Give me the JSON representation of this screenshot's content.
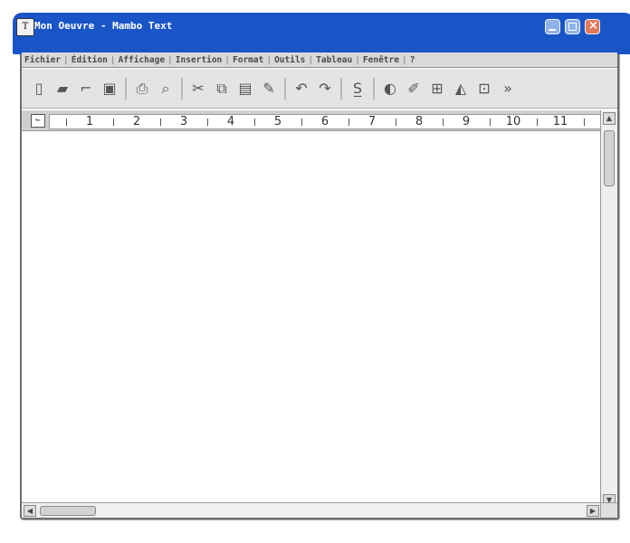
{
  "window": {
    "title": "Mon Oeuvre - Mambo Text",
    "app_icon_label": "T",
    "title_bar_color": "#1a55c8",
    "controls": {
      "minimize_icon": "minimize-icon",
      "maximize_icon": "maximize-icon",
      "close_icon": "close-icon"
    }
  },
  "menu": {
    "items": [
      "Fichier",
      "Édition",
      "Affichage",
      "Insertion",
      "Format",
      "Outils",
      "Tableau",
      "Fenêtre",
      "?"
    ]
  },
  "toolbar": {
    "buttons": [
      {
        "icon": "new-document-icon",
        "glyph": "▯"
      },
      {
        "icon": "open-folder-icon",
        "glyph": "▰"
      },
      {
        "icon": "open-file-icon",
        "glyph": "⌐"
      },
      {
        "icon": "save-icon",
        "glyph": "▣"
      },
      {
        "icon": "print-icon",
        "glyph": "⎙"
      },
      {
        "icon": "print-preview-icon",
        "glyph": "⌕"
      },
      {
        "icon": "cut-icon",
        "glyph": "✂"
      },
      {
        "icon": "copy-icon",
        "glyph": "⧉"
      },
      {
        "icon": "paste-icon",
        "glyph": "▤"
      },
      {
        "icon": "format-painter-icon",
        "glyph": "✎"
      },
      {
        "icon": "undo-icon",
        "glyph": "↶"
      },
      {
        "icon": "redo-icon",
        "glyph": "↷"
      },
      {
        "icon": "spell-check-icon",
        "glyph": "S̲"
      },
      {
        "icon": "insert-image-icon",
        "glyph": "◐"
      },
      {
        "icon": "draw-icon",
        "glyph": "✐"
      },
      {
        "icon": "insert-table-icon",
        "glyph": "⊞"
      },
      {
        "icon": "chart-icon",
        "glyph": "◭"
      },
      {
        "icon": "insert-object-icon",
        "glyph": "⊡"
      },
      {
        "icon": "more-options-icon",
        "glyph": "»"
      }
    ]
  },
  "ruler": {
    "numbers": [
      "1",
      "2",
      "3",
      "4",
      "5",
      "6",
      "7",
      "8",
      "9",
      "10",
      "11"
    ]
  },
  "document": {
    "content": ""
  }
}
